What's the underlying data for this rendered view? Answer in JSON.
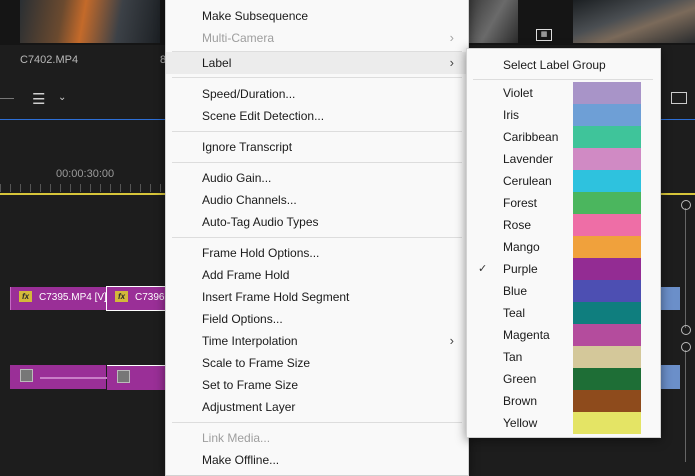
{
  "background": {
    "clip_name": "C7402.MP4",
    "clip_name_2": "8",
    "timecode": "00:00:30:00",
    "video_clip_1": "C7395.MP4 [V]",
    "video_clip_2": "C7396",
    "fx_label": "fx"
  },
  "menu": {
    "items": [
      {
        "label": "Make Subsequence",
        "enabled": true
      },
      {
        "label": "Multi-Camera",
        "enabled": false,
        "submenu": true
      },
      {
        "label": "Label",
        "enabled": true,
        "submenu": true,
        "highlighted": true
      },
      {
        "label": "Speed/Duration...",
        "enabled": true
      },
      {
        "label": "Scene Edit Detection...",
        "enabled": true
      },
      {
        "label": "Ignore Transcript",
        "enabled": true
      },
      {
        "label": "Audio Gain...",
        "enabled": true
      },
      {
        "label": "Audio Channels...",
        "enabled": true
      },
      {
        "label": "Auto-Tag Audio Types",
        "enabled": true
      },
      {
        "label": "Frame Hold Options...",
        "enabled": true
      },
      {
        "label": "Add Frame Hold",
        "enabled": true
      },
      {
        "label": "Insert Frame Hold Segment",
        "enabled": true
      },
      {
        "label": "Field Options...",
        "enabled": true
      },
      {
        "label": "Time Interpolation",
        "enabled": true,
        "submenu": true
      },
      {
        "label": "Scale to Frame Size",
        "enabled": true
      },
      {
        "label": "Set to Frame Size",
        "enabled": true
      },
      {
        "label": "Adjustment Layer",
        "enabled": true
      },
      {
        "label": "Link Media...",
        "enabled": false
      },
      {
        "label": "Make Offline...",
        "enabled": true
      }
    ]
  },
  "label_submenu": {
    "header": "Select Label Group",
    "selected": "Purple",
    "labels": [
      {
        "name": "Violet",
        "color": "#a894c8"
      },
      {
        "name": "Iris",
        "color": "#6e9fd6"
      },
      {
        "name": "Caribbean",
        "color": "#3fc49a"
      },
      {
        "name": "Lavender",
        "color": "#d08ac4"
      },
      {
        "name": "Cerulean",
        "color": "#2ec2de"
      },
      {
        "name": "Forest",
        "color": "#4bb65e"
      },
      {
        "name": "Rose",
        "color": "#ee6ea6"
      },
      {
        "name": "Mango",
        "color": "#f0a13c"
      },
      {
        "name": "Purple",
        "color": "#932c93"
      },
      {
        "name": "Blue",
        "color": "#4d4fb2"
      },
      {
        "name": "Teal",
        "color": "#0f7e7e"
      },
      {
        "name": "Magenta",
        "color": "#b44c9d"
      },
      {
        "name": "Tan",
        "color": "#d4c89a"
      },
      {
        "name": "Green",
        "color": "#1e6e36"
      },
      {
        "name": "Brown",
        "color": "#8e4b1c"
      },
      {
        "name": "Yellow",
        "color": "#e4e465"
      }
    ]
  }
}
